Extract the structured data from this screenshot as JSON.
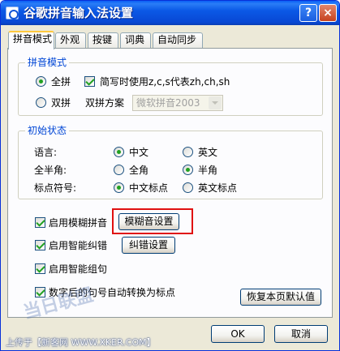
{
  "window": {
    "title": "谷歌拼音输入法设置",
    "help": "?",
    "close": "×"
  },
  "tabs": [
    {
      "label": "拼音模式"
    },
    {
      "label": "外观"
    },
    {
      "label": "按键"
    },
    {
      "label": "词典"
    },
    {
      "label": "自动同步"
    }
  ],
  "pinyin_mode": {
    "title": "拼音模式",
    "full_pinyin": {
      "label": "全拼",
      "selected": true
    },
    "abbrev": {
      "label": "简写时使用z,c,s代表zh,ch,sh",
      "checked": true
    },
    "double_pinyin": {
      "label": "双拼",
      "selected": false
    },
    "scheme_label": "双拼方案",
    "scheme_value": "微软拼音2003"
  },
  "initial_state": {
    "title": "初始状态",
    "language": {
      "label": "语言:",
      "opt1": "中文",
      "opt2": "英文",
      "selected": "中文"
    },
    "width": {
      "label": "全半角:",
      "opt1": "全角",
      "opt2": "半角",
      "selected": "半角"
    },
    "punct": {
      "label": "标点符号:",
      "opt1": "中文标点",
      "opt2": "英文标点",
      "selected": "中文标点"
    }
  },
  "options": {
    "fuzzy": {
      "label": "启用模糊拼音",
      "checked": true,
      "button": "模糊音设置"
    },
    "correction": {
      "label": "启用智能纠错",
      "checked": true,
      "button": "纠错设置"
    },
    "grouping": {
      "label": "启用智能组句",
      "checked": true
    },
    "punct_after_digit": {
      "label": "数字后的句号自动转换为标点",
      "checked": true
    },
    "restore": "恢复本页默认值"
  },
  "footer": {
    "ok": "OK",
    "cancel": "取消"
  },
  "watermark": {
    "logo": "当日联盟",
    "text": "上传于【新客网 WWW.XKER.COM】"
  }
}
